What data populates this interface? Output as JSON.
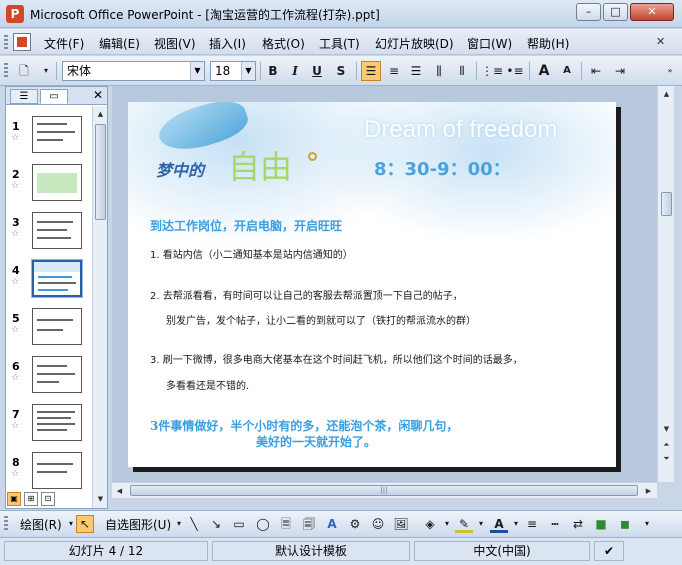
{
  "window": {
    "title": "Microsoft Office PowerPoint - [淘宝运营的工作流程(打杂).ppt]",
    "minimize": "–",
    "maximize": "□",
    "close": "✕"
  },
  "menu": {
    "items": [
      "文件(F)",
      "编辑(E)",
      "视图(V)",
      "插入(I)",
      "格式(O)",
      "工具(T)",
      "幻灯片放映(D)",
      "窗口(W)",
      "帮助(H)"
    ],
    "mdi_close": "✕"
  },
  "toolbar": {
    "font_name": "宋体",
    "font_size": "18",
    "bold": "B",
    "italic": "I",
    "underline": "U",
    "shadow": "S",
    "grow_font": "A",
    "shrink_font": "A"
  },
  "slides_pane": {
    "tab_outline_icon": "outline-icon",
    "tab_slides_icon": "slides-icon",
    "close": "✕",
    "slide_numbers": [
      "1",
      "2",
      "3",
      "4",
      "5",
      "6",
      "7",
      "8"
    ],
    "star": "☆",
    "selected_index": 4
  },
  "slide": {
    "watermark": "Dream of freedom",
    "title_small": "梦中的",
    "title_big": "自由",
    "time": "8：30-9：00：",
    "heading": "到达工作岗位，开启电脑，开启旺旺",
    "line1": "1. 看站内信（小二通知基本是站内信通知的）",
    "line2": "2. 去帮派看看，有时间可以让自己的客服去帮派置顶一下自己的帖子，",
    "line2b": "别发广告，发个帖子，让小二看的到就可以了（铁打的帮派流水的群）",
    "line3": "3. 刷一下微博，很多电商大佬基本在这个时间赶飞机，所以他们这个时间的话最多，",
    "line3b": "多看看还是不错的.",
    "closing1": "3件事情做好，半个小时有的多，还能泡个茶，闲聊几句，",
    "closing2": "美好的一天就开始了。"
  },
  "drawing_toolbar": {
    "draw_label": "绘图(R)",
    "autoshapes_label": "自选图形(U)"
  },
  "status": {
    "slide_pos": "幻灯片 4 / 12",
    "template": "默认设计模板",
    "language": "中文(中国)"
  }
}
